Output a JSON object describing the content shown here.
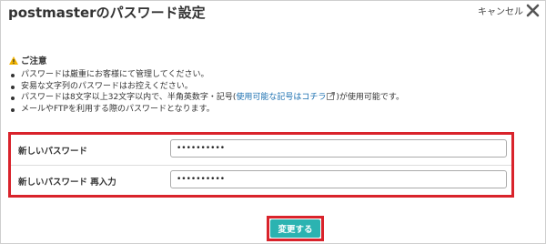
{
  "dialog": {
    "title": "postmasterのパスワード設定",
    "cancel_label": "キャンセル"
  },
  "notice": {
    "heading": "ご注意",
    "items": [
      "パスワードは厳重にお客様にて管理してください。",
      "安易な文字列のパスワードはお控えください。",
      "メールやFTPを利用する際のパスワードとなります。"
    ],
    "rule": {
      "before": "パスワードは8文字以上32文字以内で、半角英数字・記号(",
      "link": "使用可能な記号はコチラ",
      "after": ")が使用可能です。"
    }
  },
  "form": {
    "new_password_label": "新しいパスワード",
    "new_password_value": "••••••••••",
    "confirm_password_label": "新しいパスワード 再入力",
    "confirm_password_value": "••••••••••"
  },
  "actions": {
    "submit_label": "変更する"
  },
  "colors": {
    "highlight": "#d9232b",
    "button": "#2bb3b1",
    "link": "#1a6fb0"
  }
}
